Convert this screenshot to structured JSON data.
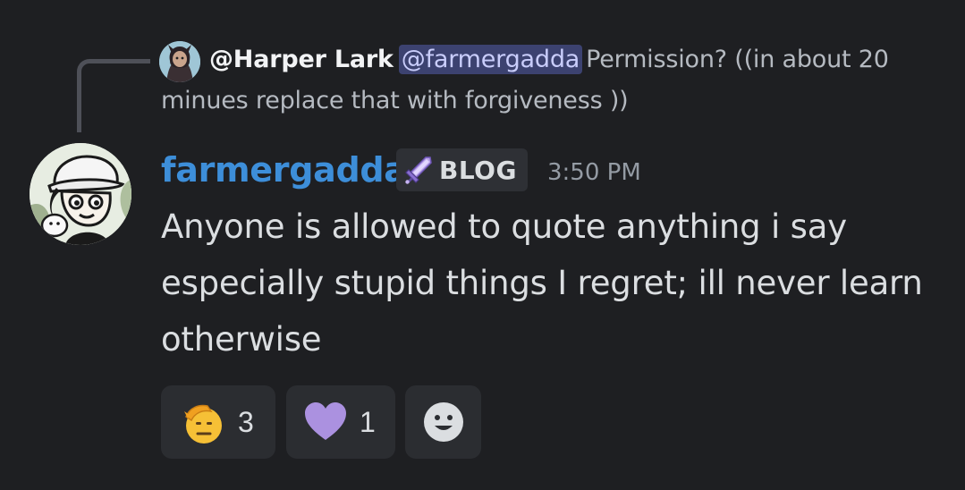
{
  "reply": {
    "author": "@Harper Lark",
    "mention": "@farmergadda",
    "text": "Permission? ((in about 20 minues replace that with forgiveness ))"
  },
  "message": {
    "username": "farmergadda",
    "username_color": "#3d8ed9",
    "tag": {
      "icon": "sword-icon",
      "label": "BLOG"
    },
    "timestamp": "3:50 PM",
    "body": "Anyone is allowed to quote anything i say especially stupid things I regret; ill never learn otherwise"
  },
  "reactions": [
    {
      "emoji": "saluting-face-icon",
      "count": "3"
    },
    {
      "emoji": "purple-heart-icon",
      "count": "1",
      "color": "#ab91e0"
    },
    {
      "emoji": "add-reaction-icon"
    }
  ],
  "colors": {
    "background": "#1e1f22",
    "mention_bg": "#3c4270",
    "reaction_bg": "#2b2d31"
  }
}
